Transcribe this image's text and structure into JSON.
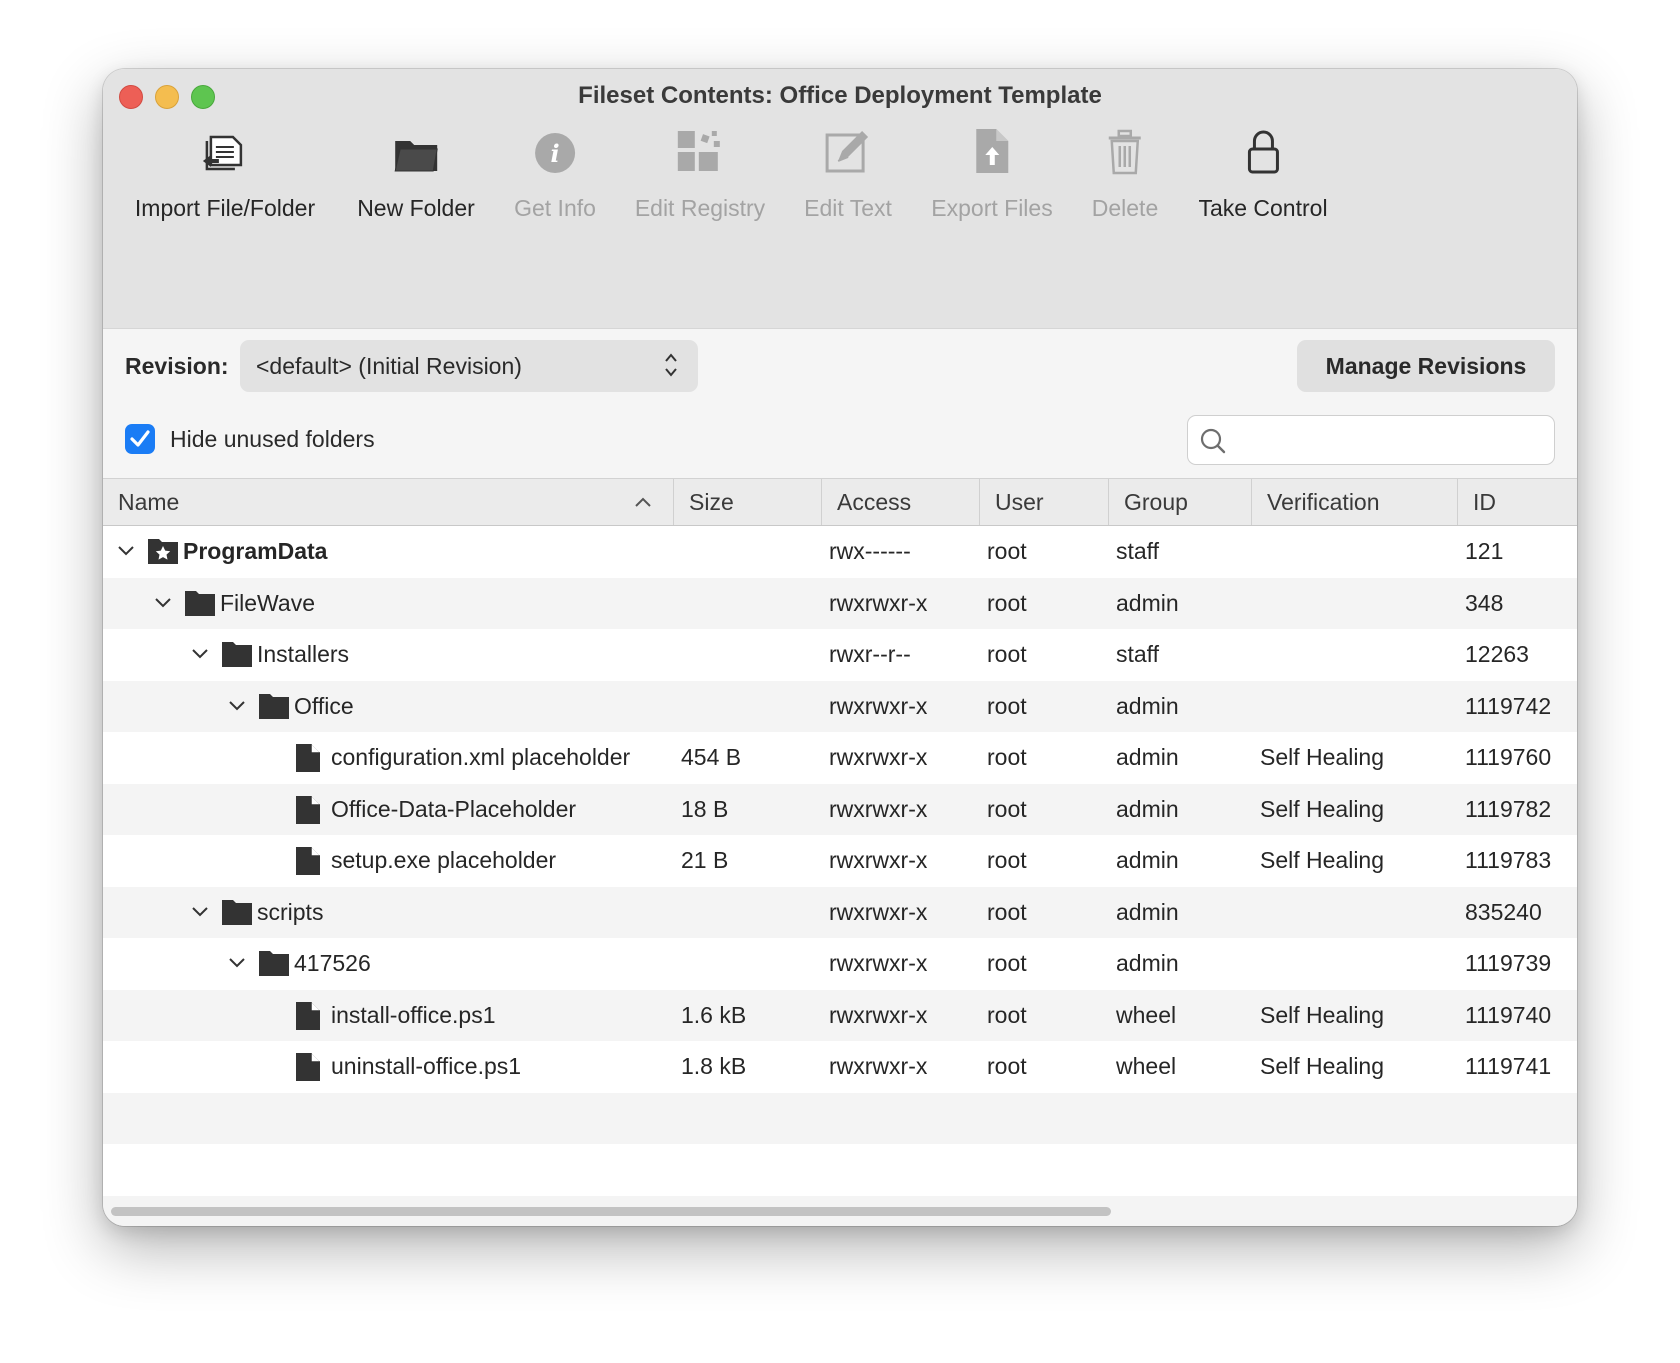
{
  "window": {
    "title": "Fileset Contents: Office Deployment Template"
  },
  "toolbar": {
    "items": [
      {
        "label": "Import File/Folder",
        "icon": "import-icon",
        "enabled": true
      },
      {
        "label": "New Folder",
        "icon": "folder-icon",
        "enabled": true
      },
      {
        "label": "Get Info",
        "icon": "info-icon",
        "enabled": false
      },
      {
        "label": "Edit Registry",
        "icon": "registry-icon",
        "enabled": false
      },
      {
        "label": "Edit Text",
        "icon": "edit-text-icon",
        "enabled": false
      },
      {
        "label": "Export Files",
        "icon": "export-icon",
        "enabled": false
      },
      {
        "label": "Delete",
        "icon": "trash-icon",
        "enabled": false
      },
      {
        "label": "Take Control",
        "icon": "lock-icon",
        "enabled": true
      }
    ]
  },
  "revision": {
    "label": "Revision:",
    "selected": "<default> (Initial Revision)",
    "manage_label": "Manage Revisions"
  },
  "filter": {
    "hide_unused_label": "Hide unused folders",
    "hide_unused_checked": true,
    "search_value": ""
  },
  "table": {
    "columns": {
      "name": "Name",
      "size": "Size",
      "access": "Access",
      "user": "User",
      "group": "Group",
      "verification": "Verification",
      "id": "ID"
    },
    "sort": {
      "column": "Name",
      "direction": "ascending"
    },
    "rows": [
      {
        "name": "ProgramData",
        "size": "",
        "access": "rwx------",
        "user": "root",
        "group": "staff",
        "verification": "",
        "id": "121",
        "type": "special-folder",
        "depth": 0,
        "expanded": true
      },
      {
        "name": "FileWave",
        "size": "",
        "access": "rwxrwxr-x",
        "user": "root",
        "group": "admin",
        "verification": "",
        "id": "348",
        "type": "folder",
        "depth": 1,
        "expanded": true
      },
      {
        "name": "Installers",
        "size": "",
        "access": "rwxr--r--",
        "user": "root",
        "group": "staff",
        "verification": "",
        "id": "12263",
        "type": "folder",
        "depth": 2,
        "expanded": true
      },
      {
        "name": "Office",
        "size": "",
        "access": "rwxrwxr-x",
        "user": "root",
        "group": "admin",
        "verification": "",
        "id": "1119742",
        "type": "folder",
        "depth": 3,
        "expanded": true
      },
      {
        "name": "configuration.xml placeholder",
        "size": "454 B",
        "access": "rwxrwxr-x",
        "user": "root",
        "group": "admin",
        "verification": "Self Healing",
        "id": "1119760",
        "type": "file",
        "depth": 4
      },
      {
        "name": "Office-Data-Placeholder",
        "size": "18 B",
        "access": "rwxrwxr-x",
        "user": "root",
        "group": "admin",
        "verification": "Self Healing",
        "id": "1119782",
        "type": "file",
        "depth": 4
      },
      {
        "name": "setup.exe placeholder",
        "size": "21 B",
        "access": "rwxrwxr-x",
        "user": "root",
        "group": "admin",
        "verification": "Self Healing",
        "id": "1119783",
        "type": "file",
        "depth": 4
      },
      {
        "name": "scripts",
        "size": "",
        "access": "rwxrwxr-x",
        "user": "root",
        "group": "admin",
        "verification": "",
        "id": "835240",
        "type": "folder",
        "depth": 2,
        "expanded": true
      },
      {
        "name": "417526",
        "size": "",
        "access": "rwxrwxr-x",
        "user": "root",
        "group": "admin",
        "verification": "",
        "id": "1119739",
        "type": "folder",
        "depth": 3,
        "expanded": true
      },
      {
        "name": "install-office.ps1",
        "size": "1.6 kB",
        "access": "rwxrwxr-x",
        "user": "root",
        "group": "wheel",
        "verification": "Self Healing",
        "id": "1119740",
        "type": "file",
        "depth": 4
      },
      {
        "name": "uninstall-office.ps1",
        "size": "1.8 kB",
        "access": "rwxrwxr-x",
        "user": "root",
        "group": "wheel",
        "verification": "Self Healing",
        "id": "1119741",
        "type": "file",
        "depth": 4
      }
    ]
  },
  "colors": {
    "accent": "#1a7cf5",
    "close": "#ed5f56",
    "minimize": "#f4bd4f",
    "zoom": "#5ec550",
    "disabled_text": "#a3a3a3"
  }
}
